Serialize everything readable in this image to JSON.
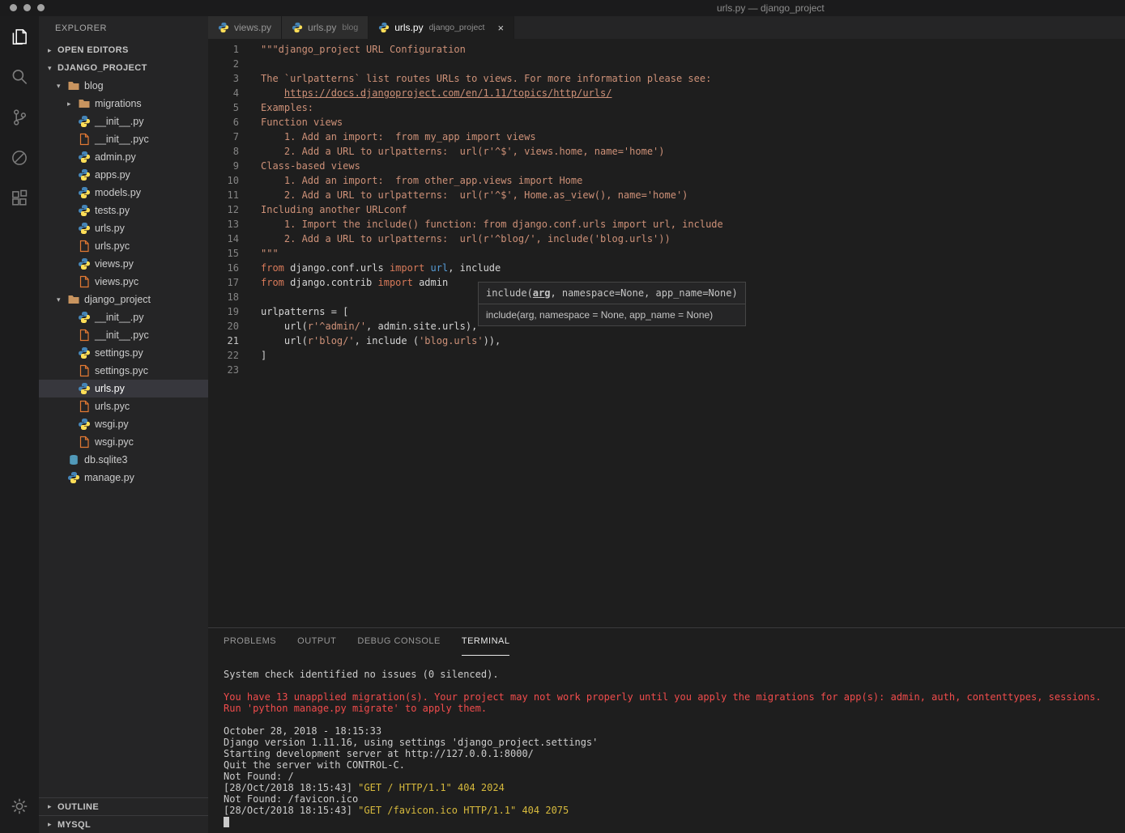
{
  "window": {
    "title": "urls.py — django_project"
  },
  "colors": {
    "plain": "#d4d4d4",
    "string": "#ce9178",
    "keyword": "#d87a5a",
    "blue": "#569cd6",
    "term_fg": "#cccccc",
    "term_red": "#f14c4c",
    "term_yellow": "#d7ba3d",
    "selected_row": "#37373d"
  },
  "glyphs": {
    "close": "×",
    "arrow_expanded": "▾",
    "arrow_collapsed": "▸"
  },
  "activity_bar": {
    "top": [
      {
        "icon": "files-icon",
        "active": true
      },
      {
        "icon": "search-icon",
        "active": false
      },
      {
        "icon": "source-control-icon",
        "active": false
      },
      {
        "icon": "debug-icon",
        "active": false
      },
      {
        "icon": "extensions-icon",
        "active": false
      }
    ],
    "bottom": [
      {
        "icon": "settings-gear-icon",
        "active": false
      }
    ]
  },
  "sidebar": {
    "header": "EXPLORER",
    "sections": {
      "open_editors": {
        "label": "OPEN EDITORS",
        "expanded": false
      },
      "project": {
        "label": "DJANGO_PROJECT",
        "expanded": true
      },
      "outline": {
        "label": "OUTLINE",
        "expanded": false
      },
      "mysql": {
        "label": "MYSQL",
        "expanded": false
      }
    },
    "tree": [
      {
        "label": "blog",
        "type": "folder",
        "indent": 0,
        "arrow": "expanded"
      },
      {
        "label": "migrations",
        "type": "folder",
        "indent": 1,
        "arrow": "collapsed"
      },
      {
        "label": "__init__.py",
        "type": "py",
        "indent": 1
      },
      {
        "label": "__init__.pyc",
        "type": "pyc",
        "indent": 1
      },
      {
        "label": "admin.py",
        "type": "py",
        "indent": 1
      },
      {
        "label": "apps.py",
        "type": "py",
        "indent": 1
      },
      {
        "label": "models.py",
        "type": "py",
        "indent": 1
      },
      {
        "label": "tests.py",
        "type": "py",
        "indent": 1
      },
      {
        "label": "urls.py",
        "type": "py",
        "indent": 1
      },
      {
        "label": "urls.pyc",
        "type": "pyc",
        "indent": 1
      },
      {
        "label": "views.py",
        "type": "py",
        "indent": 1
      },
      {
        "label": "views.pyc",
        "type": "pyc",
        "indent": 1
      },
      {
        "label": "django_project",
        "type": "folder",
        "indent": 0,
        "arrow": "expanded"
      },
      {
        "label": "__init__.py",
        "type": "py",
        "indent": 1
      },
      {
        "label": "__init__.pyc",
        "type": "pyc",
        "indent": 1
      },
      {
        "label": "settings.py",
        "type": "py",
        "indent": 1
      },
      {
        "label": "settings.pyc",
        "type": "pyc",
        "indent": 1
      },
      {
        "label": "urls.py",
        "type": "py",
        "indent": 1,
        "selected": true
      },
      {
        "label": "urls.pyc",
        "type": "pyc",
        "indent": 1
      },
      {
        "label": "wsgi.py",
        "type": "py",
        "indent": 1
      },
      {
        "label": "wsgi.pyc",
        "type": "pyc",
        "indent": 1
      },
      {
        "label": "db.sqlite3",
        "type": "db",
        "indent": 0
      },
      {
        "label": "manage.py",
        "type": "py",
        "indent": 0
      }
    ]
  },
  "tabs": [
    {
      "label": "views.py",
      "detail": "",
      "active": false
    },
    {
      "label": "urls.py",
      "detail": "blog",
      "active": false
    },
    {
      "label": "urls.py",
      "detail": "django_project",
      "active": true
    }
  ],
  "editor": {
    "active_line": 21,
    "lines": [
      {
        "num": 1,
        "segments": [
          {
            "text": "\"\"\"django_project URL Configuration",
            "color": "string"
          }
        ]
      },
      {
        "num": 2,
        "segments": []
      },
      {
        "num": 3,
        "segments": [
          {
            "text": "The `urlpatterns` list routes URLs to views. For more information please see:",
            "color": "string"
          }
        ]
      },
      {
        "num": 4,
        "segments": [
          {
            "text": "    ",
            "color": "string"
          },
          {
            "text": "https://docs.djangoproject.com/en/1.11/topics/http/urls/",
            "color": "string",
            "underline": true
          }
        ]
      },
      {
        "num": 5,
        "segments": [
          {
            "text": "Examples:",
            "color": "string"
          }
        ]
      },
      {
        "num": 6,
        "segments": [
          {
            "text": "Function views",
            "color": "string"
          }
        ]
      },
      {
        "num": 7,
        "segments": [
          {
            "text": "    1. Add an import:  from my_app import views",
            "color": "string"
          }
        ]
      },
      {
        "num": 8,
        "segments": [
          {
            "text": "    2. Add a URL to urlpatterns:  url(r'^$', views.home, name='home')",
            "color": "string"
          }
        ]
      },
      {
        "num": 9,
        "segments": [
          {
            "text": "Class-based views",
            "color": "string"
          }
        ]
      },
      {
        "num": 10,
        "segments": [
          {
            "text": "    1. Add an import:  from other_app.views import Home",
            "color": "string"
          }
        ]
      },
      {
        "num": 11,
        "segments": [
          {
            "text": "    2. Add a URL to urlpatterns:  url(r'^$', Home.as_view(), name='home')",
            "color": "string"
          }
        ]
      },
      {
        "num": 12,
        "segments": [
          {
            "text": "Including another URLconf",
            "color": "string"
          }
        ]
      },
      {
        "num": 13,
        "segments": [
          {
            "text": "    1. Import the include() function: from django.conf.urls import url, include",
            "color": "string"
          }
        ]
      },
      {
        "num": 14,
        "segments": [
          {
            "text": "    2. Add a URL to urlpatterns:  url(r'^blog/', include('blog.urls'))",
            "color": "string"
          }
        ]
      },
      {
        "num": 15,
        "segments": [
          {
            "text": "\"\"\"",
            "color": "string"
          }
        ]
      },
      {
        "num": 16,
        "segments": [
          {
            "text": "from",
            "color": "keyword"
          },
          {
            "text": " django.conf.urls ",
            "color": "plain"
          },
          {
            "text": "import",
            "color": "keyword"
          },
          {
            "text": " url",
            "color": "blue"
          },
          {
            "text": ", include",
            "color": "plain"
          }
        ]
      },
      {
        "num": 17,
        "segments": [
          {
            "text": "from",
            "color": "keyword"
          },
          {
            "text": " django.contrib ",
            "color": "plain"
          },
          {
            "text": "import",
            "color": "keyword"
          },
          {
            "text": " admin",
            "color": "plain"
          }
        ]
      },
      {
        "num": 18,
        "segments": []
      },
      {
        "num": 19,
        "segments": [
          {
            "text": "urlpatterns = [",
            "color": "plain"
          }
        ]
      },
      {
        "num": 20,
        "segments": [
          {
            "text": "    url(",
            "color": "plain"
          },
          {
            "text": "r'^admin/'",
            "color": "string"
          },
          {
            "text": ", admin.site.urls),",
            "color": "plain"
          }
        ]
      },
      {
        "num": 21,
        "segments": [
          {
            "text": "    url(",
            "color": "plain"
          },
          {
            "text": "r'blog/'",
            "color": "string"
          },
          {
            "text": ", include (",
            "color": "plain"
          },
          {
            "text": "'blog.urls'",
            "color": "string"
          },
          {
            "text": ")),",
            "color": "plain"
          }
        ]
      },
      {
        "num": 22,
        "segments": [
          {
            "text": "]",
            "color": "plain"
          }
        ]
      },
      {
        "num": 23,
        "segments": []
      }
    ]
  },
  "tooltip": {
    "signature_pre": "include(",
    "signature_param": "arg",
    "signature_post": ", namespace=None, app_name=None)",
    "documentation": "include(arg, namespace = None, app_name = None)"
  },
  "panel": {
    "tabs": [
      "PROBLEMS",
      "OUTPUT",
      "DEBUG CONSOLE",
      "TERMINAL"
    ],
    "active_tab": "TERMINAL"
  },
  "terminal": {
    "cursor": true,
    "lines": [
      {
        "segments": [
          {
            "text": "System check identified no issues (0 silenced).",
            "color": "term_fg"
          }
        ]
      },
      {
        "segments": []
      },
      {
        "segments": [
          {
            "text": "You have 13 unapplied migration(s). Your project may not work properly until you apply the migrations for app(s): admin, auth, contenttypes, sessions.",
            "color": "term_red"
          }
        ]
      },
      {
        "segments": [
          {
            "text": "Run 'python manage.py migrate' to apply them.",
            "color": "term_red"
          }
        ]
      },
      {
        "segments": []
      },
      {
        "segments": [
          {
            "text": "October 28, 2018 - 18:15:33",
            "color": "term_fg"
          }
        ]
      },
      {
        "segments": [
          {
            "text": "Django version 1.11.16, using settings 'django_project.settings'",
            "color": "term_fg"
          }
        ]
      },
      {
        "segments": [
          {
            "text": "Starting development server at http://127.0.0.1:8000/",
            "color": "term_fg"
          }
        ]
      },
      {
        "segments": [
          {
            "text": "Quit the server with CONTROL-C.",
            "color": "term_fg"
          }
        ]
      },
      {
        "segments": [
          {
            "text": "Not Found: /",
            "color": "term_fg"
          }
        ]
      },
      {
        "segments": [
          {
            "text": "[28/Oct/2018 18:15:43] ",
            "color": "term_fg"
          },
          {
            "text": "\"GET / HTTP/1.1\" 404 2024",
            "color": "term_yellow"
          }
        ]
      },
      {
        "segments": [
          {
            "text": "Not Found: /favicon.ico",
            "color": "term_fg"
          }
        ]
      },
      {
        "segments": [
          {
            "text": "[28/Oct/2018 18:15:43] ",
            "color": "term_fg"
          },
          {
            "text": "\"GET /favicon.ico HTTP/1.1\" 404 2075",
            "color": "term_yellow"
          }
        ]
      }
    ]
  }
}
